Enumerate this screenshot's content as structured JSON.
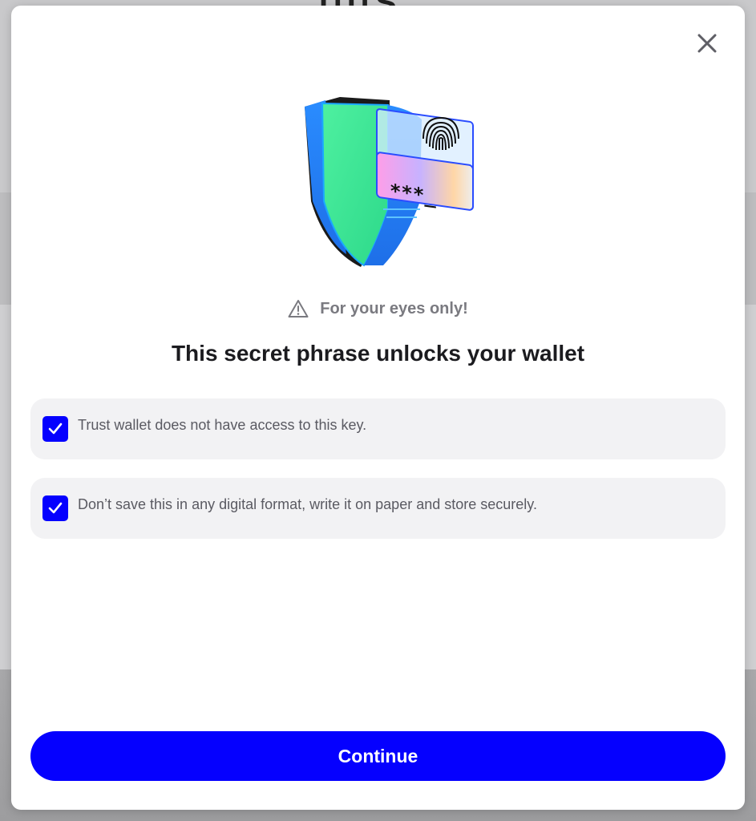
{
  "backdrop": {
    "logo_text": "ПЦS"
  },
  "modal": {
    "close_icon": "close-icon",
    "illustration_icon": "shield-fingerprint-password-illustration",
    "warning": {
      "icon": "warning-triangle-icon",
      "text": "For your eyes only!"
    },
    "title": "This secret phrase unlocks your wallet",
    "items": [
      {
        "text": "Trust wallet does not have access to this key.",
        "checked": true
      },
      {
        "text": "Don’t save this in any digital format, write it on paper and store securely.",
        "checked": true
      }
    ],
    "continue_label": "Continue"
  },
  "colors": {
    "accent": "#0500ff",
    "item_background": "#f2f2f4",
    "warning_text": "#7a7a80",
    "title_text": "#1b1b1f"
  }
}
